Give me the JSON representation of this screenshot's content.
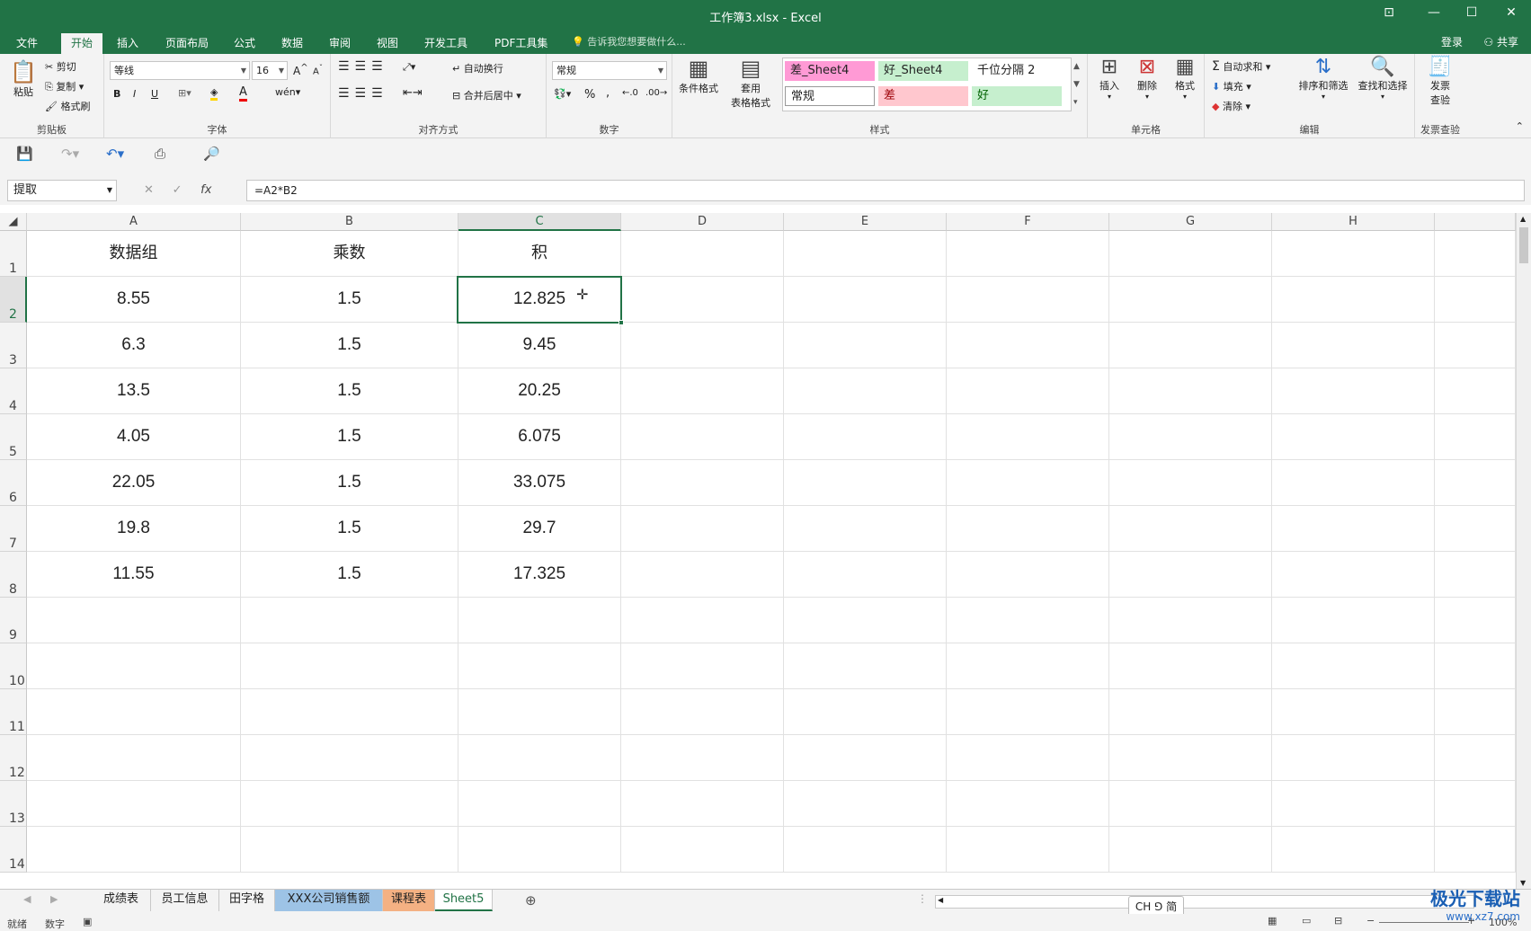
{
  "window": {
    "title": "工作簿3.xlsx - Excel"
  },
  "ribbon_tabs": [
    "文件",
    "开始",
    "插入",
    "页面布局",
    "公式",
    "数据",
    "审阅",
    "视图",
    "开发工具",
    "PDF工具集"
  ],
  "active_tab": "开始",
  "tell_me": "告诉我您想要做什么...",
  "login": "登录",
  "share": "共享",
  "clipboard": {
    "paste": "粘贴",
    "cut": "剪切",
    "copy": "复制",
    "format_painter": "格式刷",
    "label": "剪贴板"
  },
  "font": {
    "name": "等线",
    "size": "16",
    "label": "字体",
    "bold": "B",
    "italic": "I",
    "underline": "U"
  },
  "alignment": {
    "wrap": "自动换行",
    "merge": "合并后居中",
    "label": "对齐方式"
  },
  "number": {
    "format": "常规",
    "percent": "%",
    "comma": ",",
    "label": "数字"
  },
  "styles": {
    "conditional": "条件格式",
    "table_format_1": "套用",
    "table_format_2": "表格格式",
    "cells": [
      {
        "text": "差_Sheet4",
        "bg": "#ff9ad5"
      },
      {
        "text": "好_Sheet4",
        "bg": "#c6efce"
      },
      {
        "text": "千位分隔 2",
        "bg": "#ffffff"
      },
      {
        "text": "常规",
        "bg": "#ffffff"
      },
      {
        "text": "差",
        "bg": "#ffc7ce"
      },
      {
        "text": "好",
        "bg": "#c6efce"
      }
    ],
    "label": "样式"
  },
  "cells_group": {
    "insert": "插入",
    "delete": "删除",
    "format": "格式",
    "label": "单元格"
  },
  "editing": {
    "autosum": "自动求和",
    "fill": "填充",
    "clear": "清除",
    "sort": "排序和筛选",
    "find": "查找和选择",
    "label": "编辑"
  },
  "invoice": {
    "line1": "发票",
    "line2": "查验",
    "label": "发票查验"
  },
  "name_box": "提取",
  "formula": "=A2*B2",
  "columns": [
    "A",
    "B",
    "C",
    "D",
    "E",
    "F",
    "G",
    "H"
  ],
  "rows": [
    "1",
    "2",
    "3",
    "4",
    "5",
    "6",
    "7",
    "8",
    "9",
    "10",
    "11",
    "12",
    "13",
    "14"
  ],
  "table": {
    "headers": [
      "数据组",
      "乘数",
      "积"
    ],
    "data": [
      [
        "8.55",
        "1.5",
        "12.825"
      ],
      [
        "6.3",
        "1.5",
        "9.45"
      ],
      [
        "13.5",
        "1.5",
        "20.25"
      ],
      [
        "4.05",
        "1.5",
        "6.075"
      ],
      [
        "22.05",
        "1.5",
        "33.075"
      ],
      [
        "19.8",
        "1.5",
        "29.7"
      ],
      [
        "11.55",
        "1.5",
        "17.325"
      ]
    ]
  },
  "sheet_tabs": [
    {
      "name": "成绩表",
      "color": ""
    },
    {
      "name": "员工信息",
      "color": ""
    },
    {
      "name": "田字格",
      "color": ""
    },
    {
      "name": "XXX公司销售额",
      "color": "#9dc3e6"
    },
    {
      "name": "课程表",
      "color": "#f4b183"
    },
    {
      "name": "Sheet5",
      "color": ""
    }
  ],
  "active_sheet": "Sheet5",
  "status": {
    "ready": "就绪",
    "mode": "数字",
    "zoom": "100%"
  },
  "ime": "CH ⅁ 简",
  "watermark": {
    "line1": "极光下载站",
    "line2": "www.xz7.com"
  }
}
